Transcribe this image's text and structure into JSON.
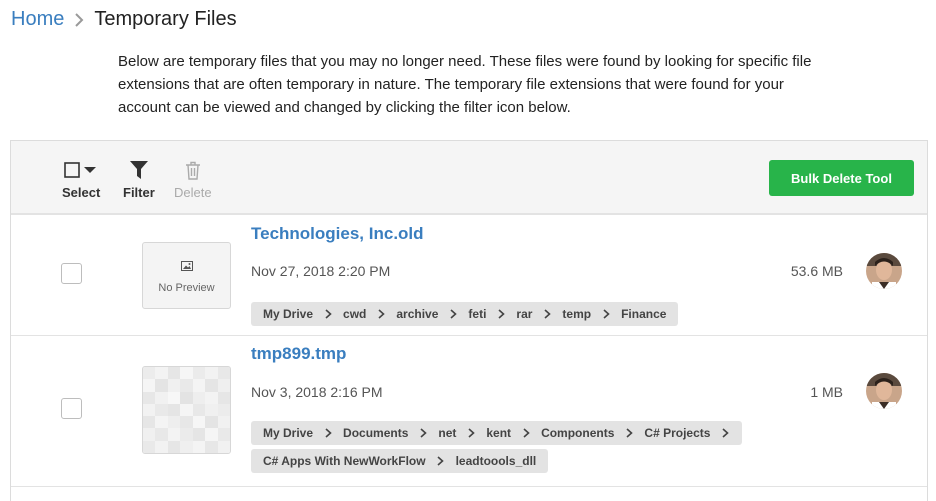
{
  "breadcrumb": {
    "home": "Home",
    "current": "Temporary Files"
  },
  "intro": "Below are temporary files that you may no longer need. These files were found by looking for specific file extensions that are often temporary in nature. The temporary file extensions that were found for your account can be viewed and changed by clicking the filter icon below.",
  "toolbar": {
    "select_label": "Select",
    "filter_label": "Filter",
    "delete_label": "Delete",
    "bulk_delete_label": "Bulk Delete Tool"
  },
  "files": [
    {
      "name": "Technologies, Inc.old",
      "date": "Nov 27, 2018 2:20 PM",
      "size": "53.6 MB",
      "preview_text": "No Preview",
      "path": [
        "My Drive",
        "cwd",
        "archive",
        "feti",
        "rar",
        "temp",
        "Finance"
      ]
    },
    {
      "name": "tmp899.tmp",
      "date": "Nov 3, 2018 2:16 PM",
      "size": "1 MB",
      "path_line1": [
        "My Drive",
        "Documents",
        "net",
        "kent",
        "Components",
        "C# Projects"
      ],
      "path_line2": [
        "C# Apps With NewWorkFlow",
        "leadtoools_dll"
      ]
    }
  ],
  "colors": {
    "link": "#3a7ebf",
    "bulk_button": "#28b44a",
    "toolbar_bg": "#f5f5f5",
    "path_bg": "#e3e3e3"
  },
  "icons": {
    "breadcrumb_separator": "chevron-right-icon",
    "select": "checkbox-dropdown-icon",
    "filter": "filter-icon",
    "delete": "trash-icon",
    "no_preview": "image-icon",
    "path_separator": "chevron-right-icon"
  }
}
